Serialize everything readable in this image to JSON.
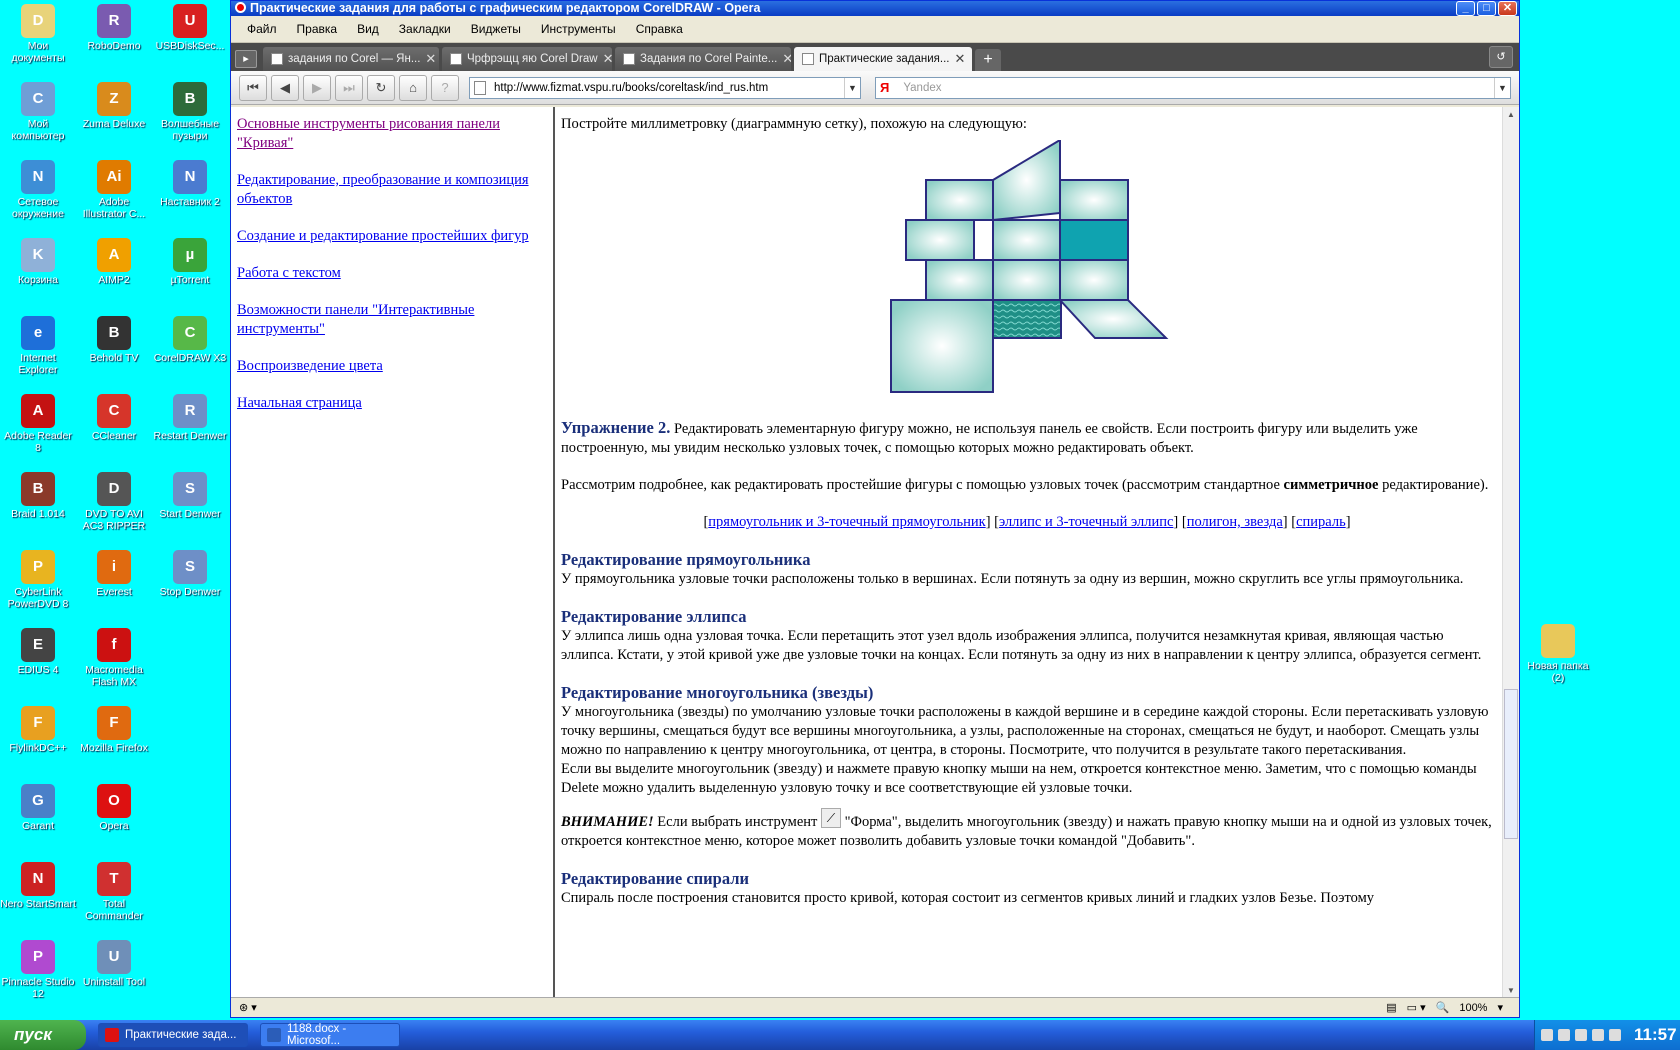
{
  "desktop": {
    "icons": [
      {
        "label": "Мои документы",
        "icon": "folder-docs-icon",
        "color": "#e8d37a",
        "glyph": "D"
      },
      {
        "label": "RoboDemo",
        "icon": "robodemo-icon",
        "color": "#7a5bb0",
        "glyph": "R"
      },
      {
        "label": "USBDiskSec...",
        "icon": "usb-icon",
        "color": "#d82020",
        "glyph": "U"
      },
      {
        "label": "Мой компьютер",
        "icon": "computer-icon",
        "color": "#6f9ed6",
        "glyph": "C"
      },
      {
        "label": "Zuma Deluxe",
        "icon": "zuma-icon",
        "color": "#d98b1c",
        "glyph": "Z"
      },
      {
        "label": "Волшебные пузыри",
        "icon": "bubbles-icon",
        "color": "#2d6b3a",
        "glyph": "B"
      },
      {
        "label": "Сетевое окружение",
        "icon": "network-icon",
        "color": "#3d8ed6",
        "glyph": "N"
      },
      {
        "label": "Adobe Illustrator C...",
        "icon": "illustrator-icon",
        "color": "#e07b00",
        "glyph": "Ai"
      },
      {
        "label": "Наставник 2",
        "icon": "nastavnik-icon",
        "color": "#4b7bd0",
        "glyph": "N"
      },
      {
        "label": "Корзина",
        "icon": "recycle-bin-icon",
        "color": "#8fb1d8",
        "glyph": "K"
      },
      {
        "label": "AIMP2",
        "icon": "aimp-icon",
        "color": "#f0a000",
        "glyph": "A"
      },
      {
        "label": "µTorrent",
        "icon": "utorrent-icon",
        "color": "#3aa43a",
        "glyph": "µ"
      },
      {
        "label": "Internet Explorer",
        "icon": "ie-icon",
        "color": "#1e6fd9",
        "glyph": "e"
      },
      {
        "label": "Behold TV",
        "icon": "beholdtv-icon",
        "color": "#333333",
        "glyph": "B"
      },
      {
        "label": "CorelDRAW X3",
        "icon": "coreldraw-icon",
        "color": "#57b848",
        "glyph": "C"
      },
      {
        "label": "Adobe Reader 8",
        "icon": "adobe-reader-icon",
        "color": "#c41212",
        "glyph": "A"
      },
      {
        "label": "CCleaner",
        "icon": "ccleaner-icon",
        "color": "#d6352a",
        "glyph": "C"
      },
      {
        "label": "Restart Denwer",
        "icon": "denwer-icon",
        "color": "#6e8fc7",
        "glyph": "R"
      },
      {
        "label": "Braid 1.014",
        "icon": "braid-icon",
        "color": "#8b3a2a",
        "glyph": "B"
      },
      {
        "label": "DVD TO AVI AC3 RIPPER",
        "icon": "dvd-icon",
        "color": "#555555",
        "glyph": "D"
      },
      {
        "label": "Start Denwer",
        "icon": "denwer-icon",
        "color": "#6e8fc7",
        "glyph": "S"
      },
      {
        "label": "CyberLink PowerDVD 8",
        "icon": "powerdvd-icon",
        "color": "#e8b420",
        "glyph": "P"
      },
      {
        "label": "Everest",
        "icon": "everest-icon",
        "color": "#e06a10",
        "glyph": "i"
      },
      {
        "label": "Stop Denwer",
        "icon": "denwer-icon",
        "color": "#6e8fc7",
        "glyph": "S"
      },
      {
        "label": "EDIUS 4",
        "icon": "edius-icon",
        "color": "#444444",
        "glyph": "E"
      },
      {
        "label": "Macromedia Flash MX",
        "icon": "flash-icon",
        "color": "#cc1111",
        "glyph": "f"
      },
      {
        "label": "",
        "icon": "",
        "color": "",
        "glyph": ""
      },
      {
        "label": "FlylinkDC++",
        "icon": "flylink-icon",
        "color": "#e8a020",
        "glyph": "F"
      },
      {
        "label": "Mozilla Firefox",
        "icon": "firefox-icon",
        "color": "#e06a10",
        "glyph": "F"
      },
      {
        "label": "",
        "icon": "",
        "color": "",
        "glyph": ""
      },
      {
        "label": "Garant",
        "icon": "garant-icon",
        "color": "#4a80c8",
        "glyph": "G"
      },
      {
        "label": "Opera",
        "icon": "opera-icon",
        "color": "#dd1111",
        "glyph": "O"
      },
      {
        "label": "",
        "icon": "",
        "color": "",
        "glyph": ""
      },
      {
        "label": "Nero StartSmart",
        "icon": "nero-icon",
        "color": "#cc2222",
        "glyph": "N"
      },
      {
        "label": "Total Commander",
        "icon": "total-commander-icon",
        "color": "#d03030",
        "glyph": "T"
      },
      {
        "label": "",
        "icon": "",
        "color": "",
        "glyph": ""
      },
      {
        "label": "Pinnacle Studio 12",
        "icon": "pinnacle-icon",
        "color": "#b04ad0",
        "glyph": "P"
      },
      {
        "label": "Uninstall Tool",
        "icon": "uninstall-icon",
        "color": "#6f8fb8",
        "glyph": "U"
      }
    ],
    "right_icon": {
      "label": "Новая папка (2)",
      "icon": "folder-icon",
      "color": "#e8c85a"
    }
  },
  "window": {
    "title": "Практические задания для работы с графическим редактором CorelDRAW - Opera",
    "menu": [
      "Файл",
      "Правка",
      "Вид",
      "Закладки",
      "Виджеты",
      "Инструменты",
      "Справка"
    ],
    "tabs": [
      {
        "label": "задания по Corel — Ян...",
        "active": false
      },
      {
        "label": "Чрфрэщц яю Corel Draw",
        "active": false
      },
      {
        "label": "Задания по Corel Painte...",
        "active": false
      },
      {
        "label": "Практические задания...",
        "active": true
      }
    ],
    "url": "http://www.fizmat.vspu.ru/books/coreltask/ind_rus.htm",
    "search_placeholder": "Yandex",
    "search_logo": "Я",
    "zoom": "100%"
  },
  "left_nav": [
    {
      "label": "Основные инструменты рисования панели \"Кривая\"",
      "visited": true
    },
    {
      "label": "Редактирование, преобразование и композиция объектов",
      "visited": false
    },
    {
      "label": "Создание и редактирование простейших фигур",
      "visited": false
    },
    {
      "label": "Работа с текстом",
      "visited": false
    },
    {
      "label": "Возможности панели \"Интерактивные инструменты\"",
      "visited": false
    },
    {
      "label": "Воспроизведение цвета",
      "visited": false
    },
    {
      "label": "Начальная страница",
      "visited": false
    }
  ],
  "main": {
    "intro": "Постройте миллиметровку (диаграммную сетку), похожую на следующую:",
    "ex2_title": "Упражнение 2.",
    "ex2_text": " Редактировать элементарную фигуру можно, не используя панель ее свойств. Если построить фигуру или выделить уже построенную, мы увидим несколько узловых точек, с помощью которых можно редактировать объект.",
    "p2_before": "Рассмотрим подробнее, как редактировать простейшие фигуры с помощью узловых точек (рассмотрим стандартное ",
    "p2_bold": "симметричное",
    "p2_after": " редактирование).",
    "links": [
      "прямоугольник и 3-точечный прямоугольник",
      "эллипс и 3-точечный эллипс",
      "полигон, звезда",
      "спираль"
    ],
    "h_rect": "Редактирование прямоугольника",
    "t_rect": "У прямоугольника узловые точки расположены только в вершинах. Если потянуть за одну из вершин, можно скруглить все углы прямоугольника.",
    "h_ellipse": "Редактирование эллипса",
    "t_ellipse": "У эллипса лишь одна узловая точка. Если перетащить этот узел вдоль изображения эллипса, получится незамкнутая кривая, являющая частью эллипса. Кстати, у этой кривой уже две узловые точки на концах. Если потянуть за одну из них в направлении к центру эллипса, образуется сегмент.",
    "h_poly": "Редактирование многоугольника (звезды)",
    "t_poly1": "У многоугольника (звезды) по умолчанию узловые точки расположены в каждой вершине и в середине каждой стороны. Если перетаскивать узловую точку вершины, смещаться будут все вершины многоугольника, а узлы, расположенные на сторонах, смещаться не будут, и наоборот. Смещать узлы можно по направлению к центру многоугольника, от центра, в стороны. Посмотрите, что получится в результате такого перетаскивания.",
    "t_poly2": "Если вы выделите многоугольник (звезду) и нажмете правую кнопку мыши на нем, откроется контекстное меню. Заметим, что с помощью команды Delete можно удалить выделенную узловую точку и все соответствующие ей узловые точки.",
    "warn_label": "ВНИМАНИЕ!",
    "warn_before": " Если выбрать инструмент ",
    "warn_after": " \"Форма\", выделить многоугольник (звезду) и нажать правую кнопку мыши на и одной из узловых точек, откроется контекстное меню, которое может позволить добавить узловые точки командой \"Добавить\".",
    "h_spiral": "Редактирование спирали",
    "t_spiral": "Спираль после построения становится просто кривой, которая состоит из сегментов кривых линий и гладких узлов Безье. Поэтому"
  },
  "taskbar": {
    "start": "пуск",
    "tasks": [
      {
        "label": "Практические зада...",
        "active": true,
        "color": "#dd1111"
      },
      {
        "label": "1188.docx - Microsof...",
        "active": false,
        "color": "#2b5db8"
      }
    ],
    "clock": "11:57"
  }
}
